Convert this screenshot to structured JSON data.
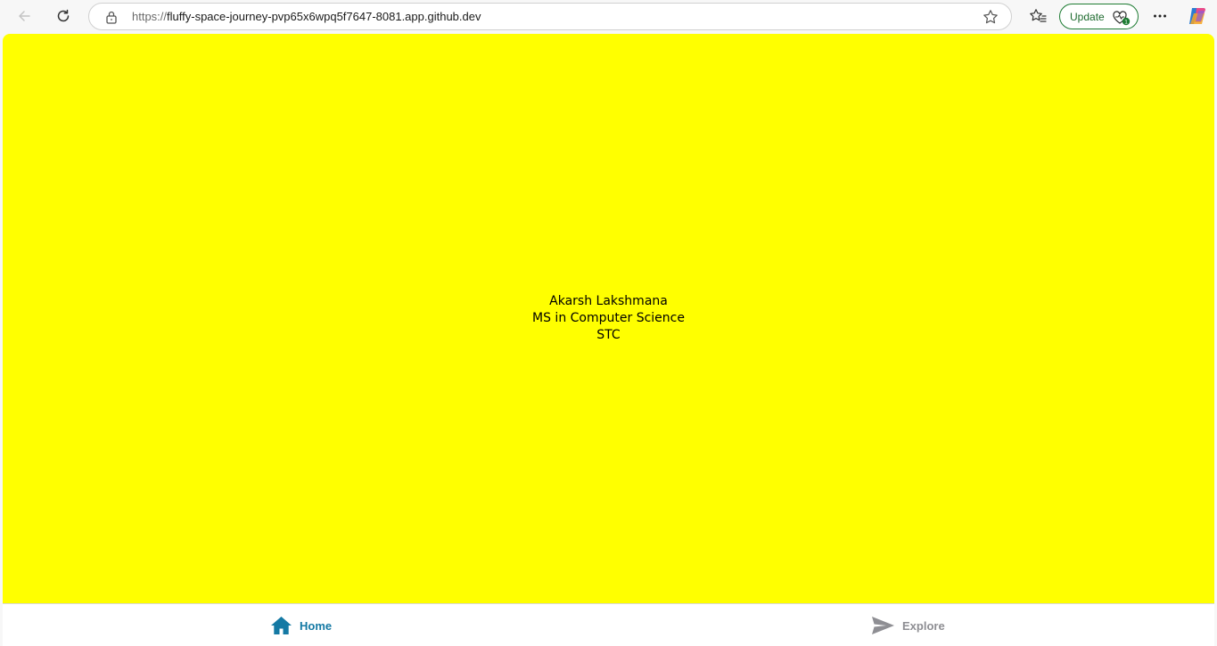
{
  "browser": {
    "url_scheme": "https://",
    "url_host": "fluffy-space-journey-pvp65x6wpq5f7647-8081.app.github.dev",
    "update_label": "Update",
    "icons": {
      "back": "back-arrow-icon",
      "reload": "reload-icon",
      "lock": "lock-icon",
      "star": "star-icon",
      "favorites": "favorites-icon",
      "update_badge": "health-badge-icon",
      "more": "more-icon",
      "copilot": "copilot-icon"
    }
  },
  "page": {
    "background": "#ffff00",
    "lines": [
      "Akarsh Lakshmana",
      "MS in Computer Science",
      "STC"
    ]
  },
  "tabbar": {
    "active_color": "#1479a4",
    "inactive_color": "#8e8e93",
    "tabs": [
      {
        "label": "Home",
        "icon": "home-icon",
        "active": true
      },
      {
        "label": "Explore",
        "icon": "send-icon",
        "active": false
      }
    ]
  }
}
